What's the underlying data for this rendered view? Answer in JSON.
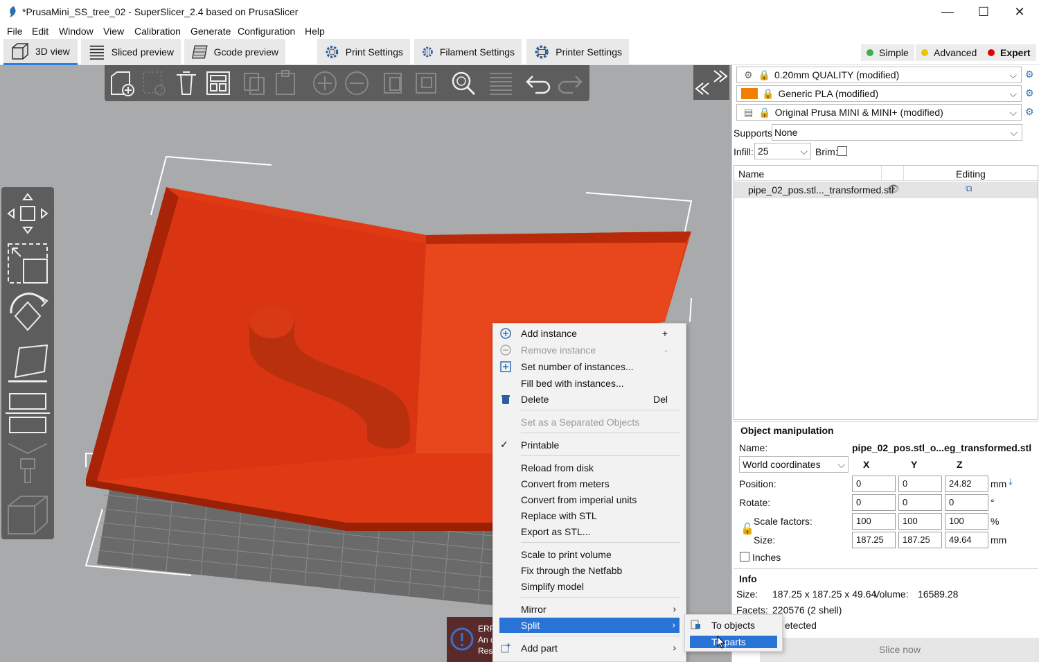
{
  "window": {
    "title": "*PrusaMini_SS_tree_02 - SuperSlicer_2.4  based on PrusaSlicer",
    "minimize": "—",
    "maximize": "☐",
    "close": "✕"
  },
  "menubar": [
    "File",
    "Edit",
    "Window",
    "View",
    "Calibration",
    "Generate",
    "Configuration",
    "Help"
  ],
  "tabs": {
    "view3d": "3D view",
    "sliced": "Sliced preview",
    "gcode": "Gcode preview",
    "print": "Print Settings",
    "filament": "Filament Settings",
    "printer": "Printer Settings"
  },
  "modes": {
    "simple": "Simple",
    "advanced": "Advanced",
    "expert": "Expert",
    "colors": {
      "simple": "#3cb043",
      "advanced": "#e3c800",
      "expert": "#e00000"
    }
  },
  "presets": {
    "print": "0.20mm QUALITY (modified)",
    "filament": "Generic PLA (modified)",
    "filament_color": "#f08000",
    "printer": "Original Prusa MINI & MINI+ (modified)"
  },
  "supports": {
    "label": "Supports:",
    "value": "None"
  },
  "infill": {
    "label": "Infill:",
    "value": "25"
  },
  "brim": {
    "label": "Brim:"
  },
  "object_list": {
    "col_name": "Name",
    "col_editing": "Editing",
    "items": [
      {
        "name": "pipe_02_pos.stl..._transformed.stl"
      }
    ]
  },
  "object_manipulation": {
    "title": "Object manipulation",
    "name_label": "Name:",
    "name_value": "pipe_02_pos.stl_o...eg_transformed.stl",
    "coords": "World coordinates",
    "axes": [
      "X",
      "Y",
      "Z"
    ],
    "position_label": "Position:",
    "position": [
      "0",
      "0",
      "24.82"
    ],
    "position_unit": "mm",
    "rotate_label": "Rotate:",
    "rotate": [
      "0",
      "0",
      "0"
    ],
    "rotate_unit": "°",
    "scale_label": "Scale factors:",
    "scale": [
      "100",
      "100",
      "100"
    ],
    "scale_unit": "%",
    "size_label": "Size:",
    "size": [
      "187.25",
      "187.25",
      "49.64"
    ],
    "size_unit": "mm",
    "inches_label": "Inches"
  },
  "info": {
    "title": "Info",
    "size_label": "Size:",
    "size_value": "187.25 x 187.25 x 49.64",
    "volume_label": "Volume:",
    "volume_value": "16589.28",
    "facets_label": "Facets:",
    "facets_value": "220576 (2 shell)",
    "errors_partial": "etected"
  },
  "slice_button": "Slice now",
  "error_notice": {
    "line1": "ERR",
    "line2": "An c",
    "line3": "Res"
  },
  "context_menu": {
    "add_instance": "Add instance",
    "add_instance_acc": "+",
    "remove_instance": "Remove instance",
    "remove_instance_acc": "-",
    "set_number": "Set number of instances...",
    "fill_bed": "Fill bed with instances...",
    "delete": "Delete",
    "delete_acc": "Del",
    "set_separated": "Set as a Separated Objects",
    "printable": "Printable",
    "reload": "Reload from disk",
    "convert_meters": "Convert from meters",
    "convert_imperial": "Convert from imperial units",
    "replace_stl": "Replace with STL",
    "export_stl": "Export as STL...",
    "scale_volume": "Scale to print volume",
    "fix_netfabb": "Fix through the Netfabb",
    "simplify": "Simplify model",
    "mirror": "Mirror",
    "split": "Split",
    "add_part": "Add part"
  },
  "split_submenu": {
    "to_objects": "To objects",
    "to_parts": "To parts"
  }
}
